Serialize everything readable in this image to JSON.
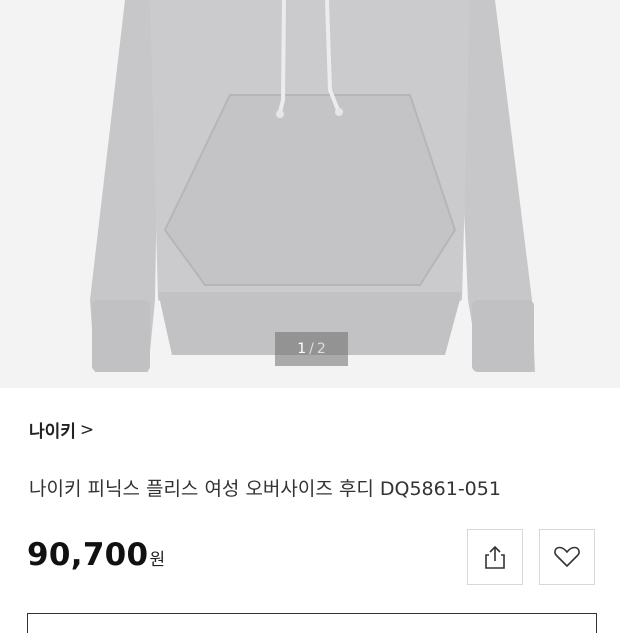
{
  "gallery": {
    "current_page": "1",
    "separator": "/",
    "total_pages": "2",
    "background_color": "#f3f3f3",
    "product_color": "#c9c9cb"
  },
  "product": {
    "brand": "나이키",
    "brand_chevron": ">",
    "title": "나이키 피닉스 플리스 여성 오버사이즈 후디 DQ5861-051",
    "price_amount": "90,700",
    "price_currency": "원"
  },
  "actions": {
    "share_icon": "share-icon",
    "wishlist_icon": "heart-icon"
  }
}
